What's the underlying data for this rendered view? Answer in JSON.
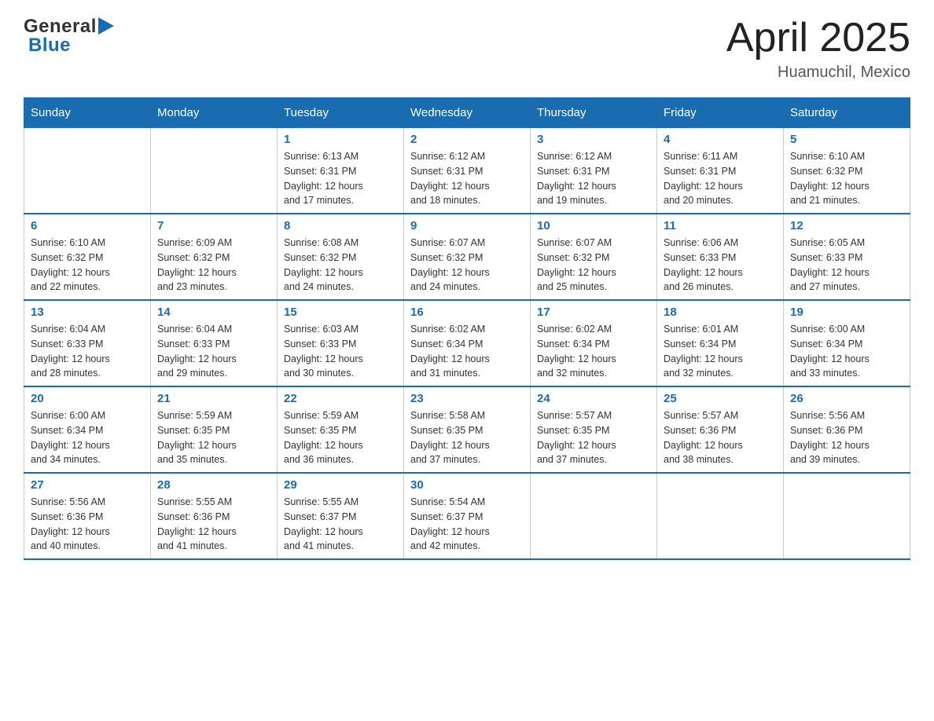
{
  "header": {
    "logo_general": "General",
    "logo_blue": "Blue",
    "title": "April 2025",
    "subtitle": "Huamuchil, Mexico"
  },
  "calendar": {
    "weekdays": [
      "Sunday",
      "Monday",
      "Tuesday",
      "Wednesday",
      "Thursday",
      "Friday",
      "Saturday"
    ],
    "weeks": [
      [
        {
          "day": "",
          "info": ""
        },
        {
          "day": "",
          "info": ""
        },
        {
          "day": "1",
          "info": "Sunrise: 6:13 AM\nSunset: 6:31 PM\nDaylight: 12 hours\nand 17 minutes."
        },
        {
          "day": "2",
          "info": "Sunrise: 6:12 AM\nSunset: 6:31 PM\nDaylight: 12 hours\nand 18 minutes."
        },
        {
          "day": "3",
          "info": "Sunrise: 6:12 AM\nSunset: 6:31 PM\nDaylight: 12 hours\nand 19 minutes."
        },
        {
          "day": "4",
          "info": "Sunrise: 6:11 AM\nSunset: 6:31 PM\nDaylight: 12 hours\nand 20 minutes."
        },
        {
          "day": "5",
          "info": "Sunrise: 6:10 AM\nSunset: 6:32 PM\nDaylight: 12 hours\nand 21 minutes."
        }
      ],
      [
        {
          "day": "6",
          "info": "Sunrise: 6:10 AM\nSunset: 6:32 PM\nDaylight: 12 hours\nand 22 minutes."
        },
        {
          "day": "7",
          "info": "Sunrise: 6:09 AM\nSunset: 6:32 PM\nDaylight: 12 hours\nand 23 minutes."
        },
        {
          "day": "8",
          "info": "Sunrise: 6:08 AM\nSunset: 6:32 PM\nDaylight: 12 hours\nand 24 minutes."
        },
        {
          "day": "9",
          "info": "Sunrise: 6:07 AM\nSunset: 6:32 PM\nDaylight: 12 hours\nand 24 minutes."
        },
        {
          "day": "10",
          "info": "Sunrise: 6:07 AM\nSunset: 6:32 PM\nDaylight: 12 hours\nand 25 minutes."
        },
        {
          "day": "11",
          "info": "Sunrise: 6:06 AM\nSunset: 6:33 PM\nDaylight: 12 hours\nand 26 minutes."
        },
        {
          "day": "12",
          "info": "Sunrise: 6:05 AM\nSunset: 6:33 PM\nDaylight: 12 hours\nand 27 minutes."
        }
      ],
      [
        {
          "day": "13",
          "info": "Sunrise: 6:04 AM\nSunset: 6:33 PM\nDaylight: 12 hours\nand 28 minutes."
        },
        {
          "day": "14",
          "info": "Sunrise: 6:04 AM\nSunset: 6:33 PM\nDaylight: 12 hours\nand 29 minutes."
        },
        {
          "day": "15",
          "info": "Sunrise: 6:03 AM\nSunset: 6:33 PM\nDaylight: 12 hours\nand 30 minutes."
        },
        {
          "day": "16",
          "info": "Sunrise: 6:02 AM\nSunset: 6:34 PM\nDaylight: 12 hours\nand 31 minutes."
        },
        {
          "day": "17",
          "info": "Sunrise: 6:02 AM\nSunset: 6:34 PM\nDaylight: 12 hours\nand 32 minutes."
        },
        {
          "day": "18",
          "info": "Sunrise: 6:01 AM\nSunset: 6:34 PM\nDaylight: 12 hours\nand 32 minutes."
        },
        {
          "day": "19",
          "info": "Sunrise: 6:00 AM\nSunset: 6:34 PM\nDaylight: 12 hours\nand 33 minutes."
        }
      ],
      [
        {
          "day": "20",
          "info": "Sunrise: 6:00 AM\nSunset: 6:34 PM\nDaylight: 12 hours\nand 34 minutes."
        },
        {
          "day": "21",
          "info": "Sunrise: 5:59 AM\nSunset: 6:35 PM\nDaylight: 12 hours\nand 35 minutes."
        },
        {
          "day": "22",
          "info": "Sunrise: 5:59 AM\nSunset: 6:35 PM\nDaylight: 12 hours\nand 36 minutes."
        },
        {
          "day": "23",
          "info": "Sunrise: 5:58 AM\nSunset: 6:35 PM\nDaylight: 12 hours\nand 37 minutes."
        },
        {
          "day": "24",
          "info": "Sunrise: 5:57 AM\nSunset: 6:35 PM\nDaylight: 12 hours\nand 37 minutes."
        },
        {
          "day": "25",
          "info": "Sunrise: 5:57 AM\nSunset: 6:36 PM\nDaylight: 12 hours\nand 38 minutes."
        },
        {
          "day": "26",
          "info": "Sunrise: 5:56 AM\nSunset: 6:36 PM\nDaylight: 12 hours\nand 39 minutes."
        }
      ],
      [
        {
          "day": "27",
          "info": "Sunrise: 5:56 AM\nSunset: 6:36 PM\nDaylight: 12 hours\nand 40 minutes."
        },
        {
          "day": "28",
          "info": "Sunrise: 5:55 AM\nSunset: 6:36 PM\nDaylight: 12 hours\nand 41 minutes."
        },
        {
          "day": "29",
          "info": "Sunrise: 5:55 AM\nSunset: 6:37 PM\nDaylight: 12 hours\nand 41 minutes."
        },
        {
          "day": "30",
          "info": "Sunrise: 5:54 AM\nSunset: 6:37 PM\nDaylight: 12 hours\nand 42 minutes."
        },
        {
          "day": "",
          "info": ""
        },
        {
          "day": "",
          "info": ""
        },
        {
          "day": "",
          "info": ""
        }
      ]
    ]
  }
}
